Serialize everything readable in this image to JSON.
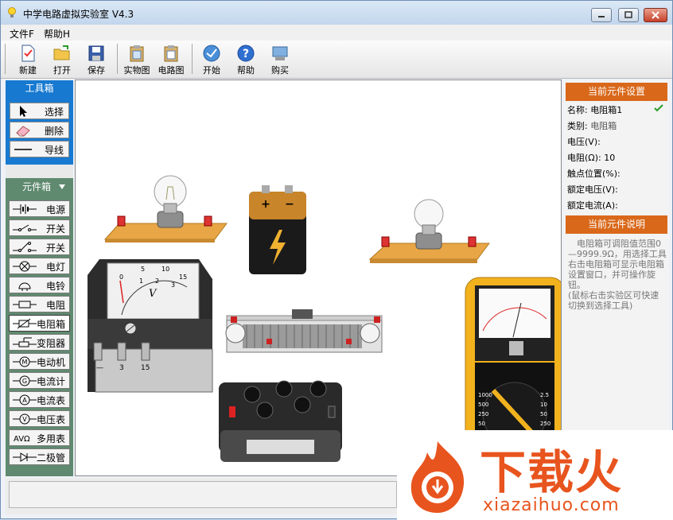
{
  "window": {
    "title": "中学电路虚拟实验室 V4.3",
    "controls": [
      "minimize",
      "maximize",
      "close"
    ]
  },
  "menu": [
    {
      "label": "文件F"
    },
    {
      "label": "帮助H"
    }
  ],
  "toolbar": {
    "new_label": "新建",
    "open_label": "打开",
    "save_label": "保存",
    "realview_label": "实物图",
    "circuitview_label": "电路图",
    "start_label": "开始",
    "help_label": "帮助",
    "buy_label": "购买"
  },
  "toolbox": {
    "title": "工具箱",
    "tools": [
      {
        "label": "选择",
        "icon": "cursor-icon"
      },
      {
        "label": "删除",
        "icon": "eraser-icon"
      },
      {
        "label": "导线",
        "icon": "wire-icon"
      }
    ]
  },
  "partbox": {
    "title": "元件箱",
    "parts": [
      {
        "label": "电源",
        "icon": "battery-symbol-icon"
      },
      {
        "label": "开关",
        "icon": "switch-symbol-icon"
      },
      {
        "label": "开关",
        "icon": "switch2-symbol-icon"
      },
      {
        "label": "电灯",
        "icon": "lamp-symbol-icon"
      },
      {
        "label": "电铃",
        "icon": "bell-symbol-icon"
      },
      {
        "label": "电阻",
        "icon": "resistor-symbol-icon"
      },
      {
        "label": "电阻箱",
        "icon": "resistor-box-symbol-icon"
      },
      {
        "label": "变阻器",
        "icon": "rheostat-symbol-icon"
      },
      {
        "label": "电动机",
        "icon": "motor-symbol-icon"
      },
      {
        "label": "电流计",
        "icon": "galvanometer-symbol-icon"
      },
      {
        "label": "电流表",
        "icon": "ammeter-symbol-icon"
      },
      {
        "label": "电压表",
        "icon": "voltmeter-symbol-icon"
      },
      {
        "label": "多用表",
        "icon": "multimeter-symbol-icon"
      },
      {
        "label": "二极管",
        "icon": "diode-symbol-icon"
      }
    ],
    "selected": "电阻箱"
  },
  "canvas": {
    "components": [
      {
        "name": "lamp-left"
      },
      {
        "name": "battery"
      },
      {
        "name": "lamp-right"
      },
      {
        "name": "voltmeter"
      },
      {
        "name": "rheostat"
      },
      {
        "name": "multimeter"
      },
      {
        "name": "resistor-box"
      }
    ],
    "voltmeter_scale": [
      "0",
      "5",
      "10",
      "15",
      "1",
      "2",
      "3"
    ],
    "voltmeter_unit": "V",
    "voltmeter_terminals": [
      "—",
      "3",
      "15"
    ]
  },
  "settings": {
    "title": "当前元件设置",
    "name_label": "名称:",
    "name_value": "电阻箱1",
    "type_label": "类别:",
    "type_value": "电阻箱",
    "voltage_label": "电压(V):",
    "voltage_value": "",
    "resistance_label": "电阻(Ω):",
    "resistance_value": "10",
    "contact_label": "触点位置(%):",
    "contact_value": "",
    "rated_voltage_label": "额定电压(V):",
    "rated_voltage_value": "",
    "rated_current_label": "额定电流(A):",
    "rated_current_value": ""
  },
  "description": {
    "title": "当前元件说明",
    "text": "电阻箱可调阻值范围0—9999.9Ω，用选择工具右击电阻箱可显示电阻箱设置窗口，并可操作旋钮。\n(鼠标右击实验区可快速切换到选择工具)"
  },
  "watermark": {
    "text": "下载火",
    "url_text": "xiazaihuo.com"
  },
  "colors": {
    "toolbox_header": "#1779d0",
    "partbox_header": "#5f8a6f",
    "panel_header": "#d9681a",
    "watermark": "#e8541e"
  }
}
